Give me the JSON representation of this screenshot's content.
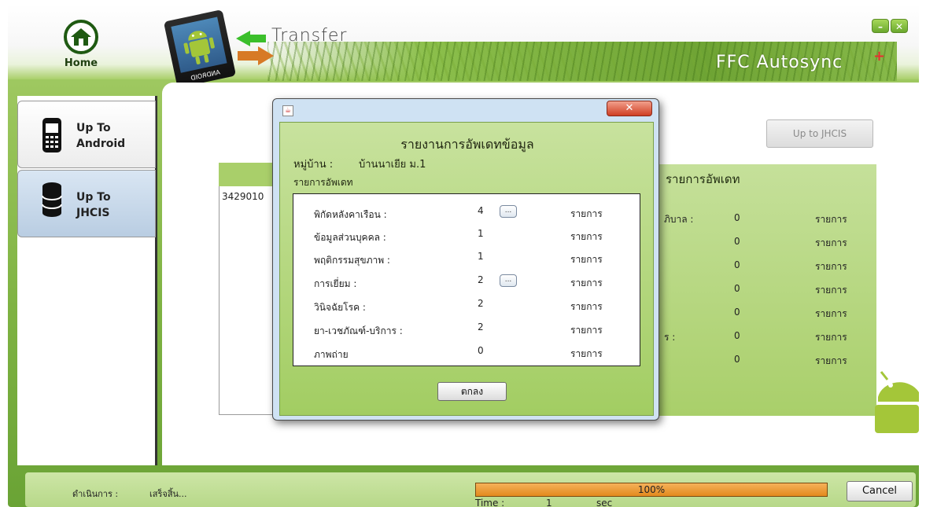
{
  "header": {
    "home_label": "Home",
    "title": "Transfer",
    "brand": "FFC Autosync",
    "brand_plus": "+",
    "tablet_brand": "ANDROID",
    "minimize_label": "–",
    "close_label": "✕"
  },
  "sidebar": {
    "items": [
      {
        "line1": "Up To",
        "line2": "Android",
        "icon": "phone-icon"
      },
      {
        "line1": "Up To",
        "line2": "JHCIS",
        "icon": "database-icon"
      }
    ]
  },
  "main": {
    "up_jhcis_button": "Up to JHCIS",
    "list_first_id": "3429010",
    "right_panel": {
      "title": "รายการอัพเดท",
      "rows": [
        {
          "label": "ภิบาล :",
          "count": "0",
          "unit": "รายการ"
        },
        {
          "label": "",
          "count": "0",
          "unit": "รายการ"
        },
        {
          "label": "",
          "count": "0",
          "unit": "รายการ"
        },
        {
          "label": "",
          "count": "0",
          "unit": "รายการ"
        },
        {
          "label": "",
          "count": "0",
          "unit": "รายการ"
        },
        {
          "label": "ร :",
          "count": "0",
          "unit": "รายการ"
        },
        {
          "label": "",
          "count": "0",
          "unit": "รายการ"
        }
      ]
    }
  },
  "dialog": {
    "title": "รายงานการอัพเดทข้อมูล",
    "village_label": "หมู่บ้าน :",
    "village_value": "บ้านนาเยีย ม.1",
    "subtitle": "รายการอัพเดท",
    "close_label": "✕",
    "rows": [
      {
        "label": "พิกัดหลังคาเรือน :",
        "count": "4",
        "unit": "รายการ",
        "has_more": true
      },
      {
        "label": "ข้อมูลส่วนบุคคล :",
        "count": "1",
        "unit": "รายการ",
        "has_more": false
      },
      {
        "label": "พฤติกรรมสุขภาพ :",
        "count": "1",
        "unit": "รายการ",
        "has_more": false
      },
      {
        "label": "การเยี่ยม :",
        "count": "2",
        "unit": "รายการ",
        "has_more": true
      },
      {
        "label": "วินิจฉัยโรค :",
        "count": "2",
        "unit": "รายการ",
        "has_more": false
      },
      {
        "label": "ยา-เวชภัณฑ์-บริการ :",
        "count": "2",
        "unit": "รายการ",
        "has_more": false
      },
      {
        "label": "ภาพถ่าย",
        "count": "0",
        "unit": "รายการ",
        "has_more": false
      }
    ],
    "more_label": "...",
    "ok_label": "ตกลง"
  },
  "status": {
    "label": "ดำเนินการ :",
    "value": "เสร็จสิ้น...",
    "progress_percent": 100,
    "progress_text": "100%",
    "time_label": "Time :",
    "time_value": "1",
    "time_unit": "sec",
    "cancel_label": "Cancel"
  }
}
